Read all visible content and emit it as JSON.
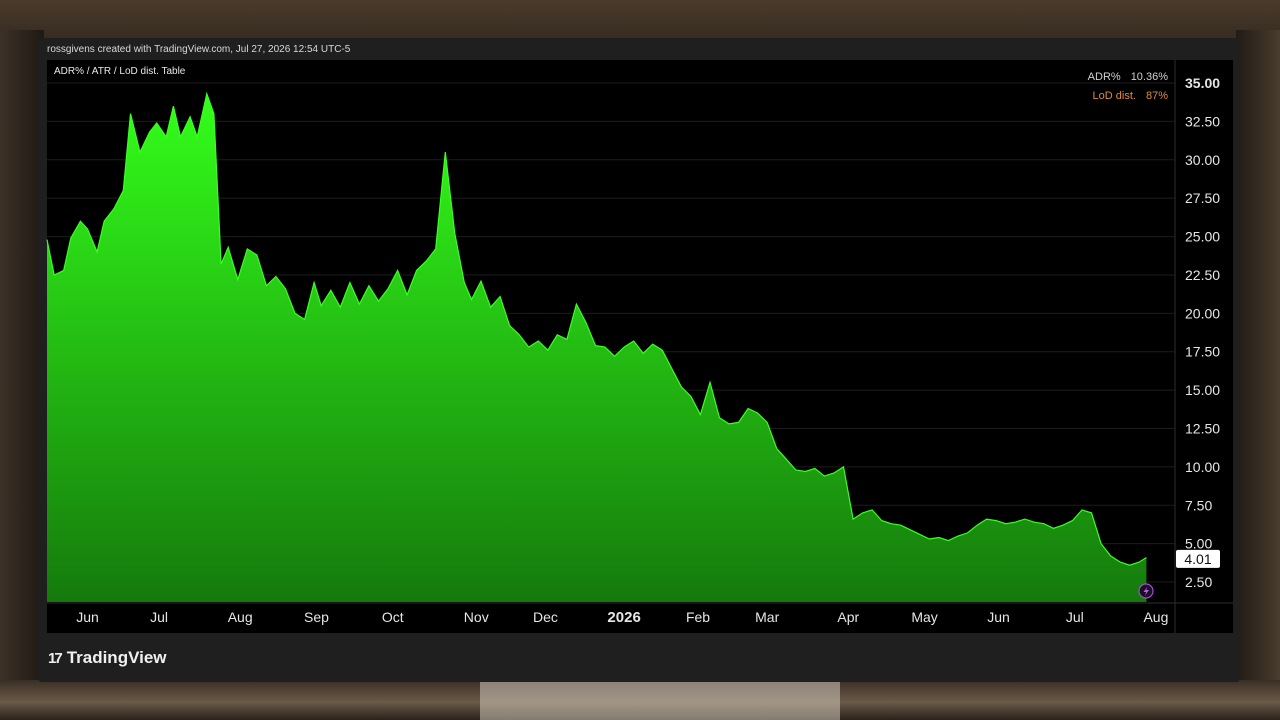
{
  "credit": "rossgivens created with TradingView.com, Jul 27, 2026 12:54 UTC-5",
  "study_title": "ADR% / ATR / LoD dist. Table",
  "legend": {
    "adr_label": "ADR%",
    "adr_value": "10.36%",
    "lod_label": "LoD dist.",
    "lod_value": "87%"
  },
  "brand": {
    "logo": "17",
    "name": "TradingView"
  },
  "colors": {
    "area_top": "#33ff1a",
    "area_bottom": "#157a0c",
    "line": "#39ff22",
    "lod": "#e08a3c"
  },
  "icons": {
    "marker": "lightning-icon"
  },
  "chart_data": {
    "type": "area",
    "title": "",
    "ylim": [
      1.2,
      36.5
    ],
    "yticks": [
      "35.00",
      "32.50",
      "30.00",
      "27.50",
      "25.00",
      "22.50",
      "20.00",
      "17.50",
      "15.00",
      "12.50",
      "10.00",
      "7.50",
      "5.00",
      "2.50"
    ],
    "ytick_values": [
      35,
      32.5,
      30,
      27.5,
      25,
      22.5,
      20,
      17.5,
      15,
      12.5,
      10,
      7.5,
      5,
      2.5
    ],
    "xticks": [
      "Jun",
      "Jul",
      "Aug",
      "Sep",
      "Oct",
      "Nov",
      "Dec",
      "2026",
      "Feb",
      "Mar",
      "Apr",
      "May",
      "Jun",
      "Jul",
      "Aug"
    ],
    "xtick_pos": [
      1.7,
      4.7,
      8.1,
      11.3,
      14.5,
      18.0,
      20.9,
      24.2,
      27.3,
      30.2,
      33.6,
      36.8,
      39.9,
      43.1,
      46.5
    ],
    "last_value": "4.01",
    "last_value_num": 4.01,
    "series": [
      {
        "values": [
          [
            0,
            24.8
          ],
          [
            0.3,
            22.5
          ],
          [
            0.7,
            22.8
          ],
          [
            1.0,
            24.9
          ],
          [
            1.4,
            26.0
          ],
          [
            1.7,
            25.5
          ],
          [
            2.1,
            24.0
          ],
          [
            2.4,
            26.0
          ],
          [
            2.8,
            26.8
          ],
          [
            3.2,
            28.0
          ],
          [
            3.5,
            33.0
          ],
          [
            3.9,
            30.5
          ],
          [
            4.3,
            31.8
          ],
          [
            4.6,
            32.4
          ],
          [
            5.0,
            31.5
          ],
          [
            5.3,
            33.5
          ],
          [
            5.6,
            31.5
          ],
          [
            6.0,
            32.8
          ],
          [
            6.3,
            31.5
          ],
          [
            6.7,
            34.3
          ],
          [
            7.0,
            33.0
          ],
          [
            7.3,
            23.2
          ],
          [
            7.6,
            24.3
          ],
          [
            8.0,
            22.2
          ],
          [
            8.4,
            24.2
          ],
          [
            8.8,
            23.8
          ],
          [
            9.2,
            21.8
          ],
          [
            9.6,
            22.4
          ],
          [
            10.0,
            21.6
          ],
          [
            10.4,
            20.0
          ],
          [
            10.8,
            19.6
          ],
          [
            11.2,
            22.0
          ],
          [
            11.5,
            20.5
          ],
          [
            11.9,
            21.5
          ],
          [
            12.3,
            20.4
          ],
          [
            12.7,
            22.0
          ],
          [
            13.1,
            20.6
          ],
          [
            13.5,
            21.8
          ],
          [
            13.9,
            20.8
          ],
          [
            14.3,
            21.6
          ],
          [
            14.7,
            22.8
          ],
          [
            15.1,
            21.2
          ],
          [
            15.5,
            22.8
          ],
          [
            15.9,
            23.4
          ],
          [
            16.3,
            24.2
          ],
          [
            16.7,
            30.5
          ],
          [
            17.1,
            25.2
          ],
          [
            17.5,
            22.0
          ],
          [
            17.8,
            20.9
          ],
          [
            18.2,
            22.1
          ],
          [
            18.6,
            20.4
          ],
          [
            19.0,
            21.1
          ],
          [
            19.4,
            19.2
          ],
          [
            19.8,
            18.6
          ],
          [
            20.2,
            17.8
          ],
          [
            20.6,
            18.2
          ],
          [
            21.0,
            17.6
          ],
          [
            21.4,
            18.6
          ],
          [
            21.8,
            18.3
          ],
          [
            22.2,
            20.6
          ],
          [
            22.6,
            19.4
          ],
          [
            23.0,
            17.9
          ],
          [
            23.4,
            17.8
          ],
          [
            23.8,
            17.2
          ],
          [
            24.2,
            17.8
          ],
          [
            24.6,
            18.2
          ],
          [
            25.0,
            17.4
          ],
          [
            25.4,
            18.0
          ],
          [
            25.8,
            17.6
          ],
          [
            26.2,
            16.4
          ],
          [
            26.6,
            15.2
          ],
          [
            27.0,
            14.6
          ],
          [
            27.4,
            13.4
          ],
          [
            27.8,
            15.5
          ],
          [
            28.2,
            13.2
          ],
          [
            28.6,
            12.8
          ],
          [
            29.0,
            12.9
          ],
          [
            29.4,
            13.8
          ],
          [
            29.8,
            13.5
          ],
          [
            30.2,
            12.9
          ],
          [
            30.6,
            11.2
          ],
          [
            31.0,
            10.5
          ],
          [
            31.4,
            9.8
          ],
          [
            31.8,
            9.7
          ],
          [
            32.2,
            9.9
          ],
          [
            32.6,
            9.4
          ],
          [
            33.0,
            9.6
          ],
          [
            33.4,
            10.0
          ],
          [
            33.8,
            6.6
          ],
          [
            34.2,
            7.0
          ],
          [
            34.6,
            7.2
          ],
          [
            35.0,
            6.5
          ],
          [
            35.4,
            6.3
          ],
          [
            35.8,
            6.2
          ],
          [
            36.2,
            5.9
          ],
          [
            36.6,
            5.6
          ],
          [
            37.0,
            5.3
          ],
          [
            37.4,
            5.4
          ],
          [
            37.8,
            5.2
          ],
          [
            38.2,
            5.5
          ],
          [
            38.6,
            5.7
          ],
          [
            39.0,
            6.2
          ],
          [
            39.4,
            6.6
          ],
          [
            39.8,
            6.5
          ],
          [
            40.2,
            6.3
          ],
          [
            40.6,
            6.4
          ],
          [
            41.0,
            6.6
          ],
          [
            41.4,
            6.4
          ],
          [
            41.8,
            6.3
          ],
          [
            42.2,
            6.0
          ],
          [
            42.6,
            6.2
          ],
          [
            43.0,
            6.5
          ],
          [
            43.4,
            7.2
          ],
          [
            43.8,
            7.0
          ],
          [
            44.2,
            5.0
          ],
          [
            44.6,
            4.2
          ],
          [
            45.0,
            3.8
          ],
          [
            45.4,
            3.6
          ],
          [
            45.8,
            3.8
          ],
          [
            46.1,
            4.1
          ]
        ]
      }
    ]
  }
}
